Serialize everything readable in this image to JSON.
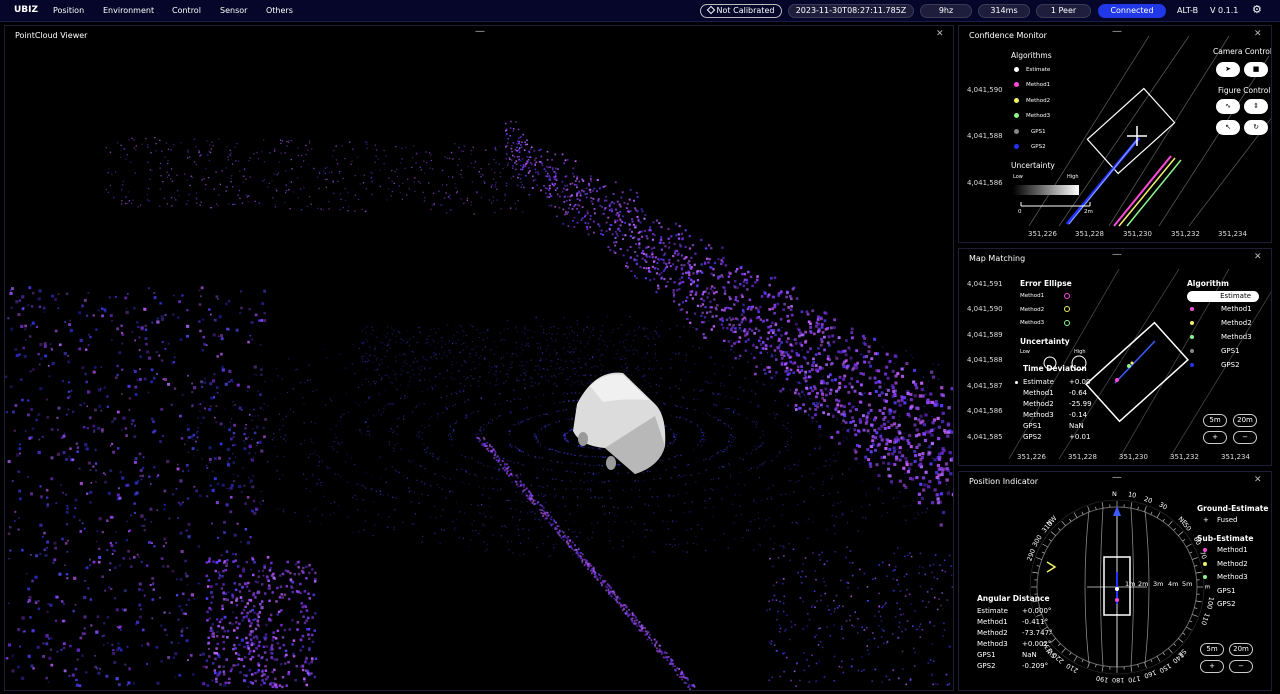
{
  "brand": "UBIZ",
  "menu": [
    "Position",
    "Environment",
    "Control",
    "Sensor",
    "Others"
  ],
  "status": {
    "calibration": "Not Calibrated",
    "timestamp": "2023-11-30T08:27:11.785Z",
    "rate": "9hz",
    "latency": "314ms",
    "peers": "1 Peer",
    "connection": "Connected",
    "device": "ALT-B",
    "version": "V 0.1.1"
  },
  "colors": {
    "accent": "#2038e8",
    "method1": "#ff4ad8",
    "method2": "#f2f26a",
    "method3": "#8cf58c",
    "gps1": "#888888",
    "gps2": "#2233ff",
    "points": "#8a3cf0"
  },
  "pointcloud": {
    "title": "PointCloud Viewer"
  },
  "confidence": {
    "title": "Confidence Monitor",
    "algorithms_title": "Algorithms",
    "legend": [
      "Estimate",
      "Method1",
      "Method2",
      "Method3",
      "GPS1",
      "GPS2"
    ],
    "uncertainty_title": "Uncertainty",
    "low": "Low",
    "high": "High",
    "scale_0": "0",
    "scale_2": "2m",
    "camera_control": "Camera Control",
    "figure_control": "Figure Control",
    "yticks": [
      "4,041,590",
      "4,041,588",
      "4,041,586"
    ],
    "xticks": [
      "351,226",
      "351,228",
      "351,230",
      "351,232",
      "351,234"
    ]
  },
  "mapmatching": {
    "title": "Map Matching",
    "error_ellipse": "Error Ellipse",
    "ellipse_items": [
      "Method1",
      "Method2",
      "Method3"
    ],
    "uncertainty": "Uncertainty",
    "low": "Low",
    "high": "High",
    "time_deviation": "Time Deviation",
    "deviation": [
      {
        "name": "Estimate",
        "value": "+0.00"
      },
      {
        "name": "Method1",
        "value": "-0.64"
      },
      {
        "name": "Method2",
        "value": "-25.99"
      },
      {
        "name": "Method3",
        "value": "-0.14"
      },
      {
        "name": "GPS1",
        "value": "NaN"
      },
      {
        "name": "GPS2",
        "value": "+0.01"
      }
    ],
    "algorithm_title": "Algorithm",
    "algorithms": [
      "Estimate",
      "Method1",
      "Method2",
      "Method3",
      "GPS1",
      "GPS2"
    ],
    "zoom_5": "5m",
    "zoom_20": "20m",
    "plus": "+",
    "minus": "−",
    "yticks": [
      "4,041,591",
      "4,041,590",
      "4,041,589",
      "4,041,588",
      "4,041,587",
      "4,041,586",
      "4,041,585"
    ],
    "xticks": [
      "351,226",
      "351,228",
      "351,230",
      "351,232",
      "351,234"
    ]
  },
  "position": {
    "title": "Position Indicator",
    "ground_estimate": "Ground-Estimate",
    "fused": "Fused",
    "sub_estimate": "Sub-Estimate",
    "sub": [
      "Method1",
      "Method2",
      "Method3",
      "GPS1",
      "GPS2"
    ],
    "angular_title": "Angular Distance",
    "angular": [
      {
        "name": "Estimate",
        "value": "+0.000°"
      },
      {
        "name": "Method1",
        "value": "-0.411°"
      },
      {
        "name": "Method2",
        "value": "-73.747°"
      },
      {
        "name": "Method3",
        "value": "+0.002°"
      },
      {
        "name": "GPS1",
        "value": "NaN"
      },
      {
        "name": "GPS2",
        "value": "-0.209°"
      }
    ],
    "ranges": [
      "1m",
      "2m",
      "3m",
      "4m",
      "5m"
    ],
    "compass": [
      {
        "label": "N",
        "deg": 0
      },
      {
        "label": "10",
        "deg": 10
      },
      {
        "label": "20",
        "deg": 20
      },
      {
        "label": "30",
        "deg": 30
      },
      {
        "label": "NE",
        "deg": 45
      },
      {
        "label": "50",
        "deg": 50
      },
      {
        "label": "60",
        "deg": 60
      },
      {
        "label": "70",
        "deg": 70
      },
      {
        "label": "E",
        "deg": 90
      },
      {
        "label": "100",
        "deg": 100
      },
      {
        "label": "110",
        "deg": 110
      },
      {
        "label": "SE",
        "deg": 135
      },
      {
        "label": "140",
        "deg": 140
      },
      {
        "label": "150",
        "deg": 150
      },
      {
        "label": "160",
        "deg": 160
      },
      {
        "label": "170",
        "deg": 170
      },
      {
        "label": "180",
        "deg": 180
      },
      {
        "label": "190",
        "deg": 190
      },
      {
        "label": "SW",
        "deg": 225
      },
      {
        "label": "210",
        "deg": 210
      },
      {
        "label": "220",
        "deg": 220
      },
      {
        "label": "230",
        "deg": 230
      },
      {
        "label": "NW",
        "deg": 315
      },
      {
        "label": "290",
        "deg": 290
      },
      {
        "label": "300",
        "deg": 300
      },
      {
        "label": "310",
        "deg": 310
      }
    ],
    "zoom_5": "5m",
    "zoom_20": "20m",
    "plus": "+",
    "minus": "−"
  }
}
